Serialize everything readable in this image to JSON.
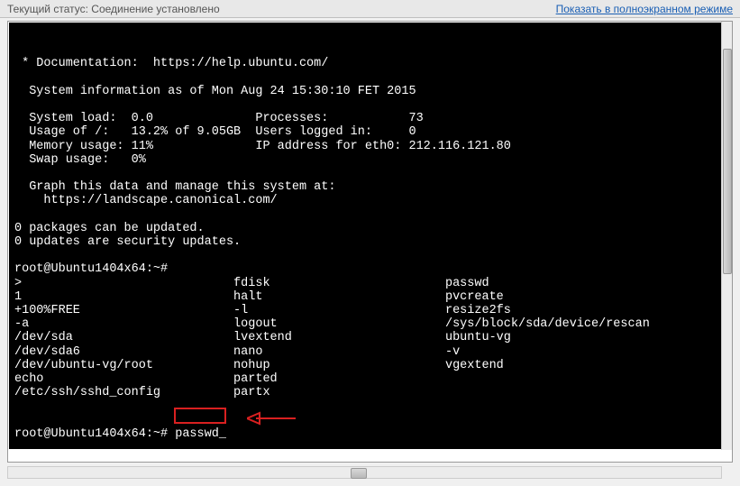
{
  "header": {
    "status_label": "Текущий статус:",
    "status_value": "Соединение установлено",
    "fullscreen_link": "Показать в полноэкранном режиме"
  },
  "terminal": {
    "lines": [
      " * Documentation:  https://help.ubuntu.com/",
      "",
      "  System information as of Mon Aug 24 15:30:10 FET 2015",
      "",
      "  System load:  0.0              Processes:           73",
      "  Usage of /:   13.2% of 9.05GB  Users logged in:     0",
      "  Memory usage: 11%              IP address for eth0: 212.116.121.80",
      "  Swap usage:   0%",
      "",
      "  Graph this data and manage this system at:",
      "    https://landscape.canonical.com/",
      "",
      "0 packages can be updated.",
      "0 updates are security updates.",
      "",
      "root@Ubuntu1404x64:~#",
      ">                             fdisk                        passwd",
      "1                             halt                         pvcreate",
      "+100%FREE                     -l                           resize2fs",
      "-a                            logout                       /sys/block/sda/device/rescan",
      "/dev/sda                      lvextend                     ubuntu-vg",
      "/dev/sda6                     nano                         -v",
      "/dev/ubuntu-vg/root           nohup                        vgextend",
      "echo                          parted",
      "/etc/ssh/sshd_config          partx"
    ],
    "prompt": "root@Ubuntu1404x64:~# ",
    "command": "passwd",
    "cursor": "_"
  },
  "annotation": {
    "highlight_target": "passwd",
    "arrow_color": "#d92020"
  }
}
